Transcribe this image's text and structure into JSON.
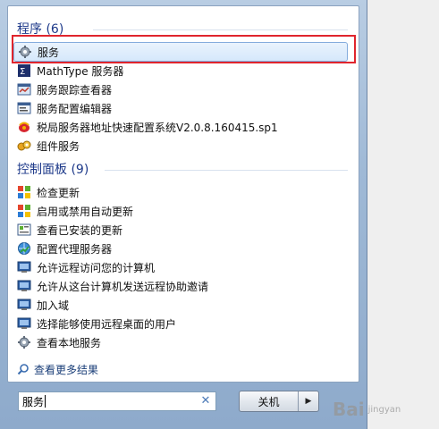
{
  "programs": {
    "header": "程序 (6)",
    "items": [
      {
        "label": "服务",
        "icon": "gear-service-icon"
      },
      {
        "label": "MathType 服务器",
        "icon": "mathtype-icon"
      },
      {
        "label": "服务跟踪查看器",
        "icon": "trace-viewer-icon"
      },
      {
        "label": "服务配置编辑器",
        "icon": "config-editor-icon"
      },
      {
        "label": "税局服务器地址快速配置系统V2.0.8.160415.sp1",
        "icon": "tax-config-icon"
      },
      {
        "label": "组件服务",
        "icon": "component-services-icon"
      }
    ]
  },
  "control_panel": {
    "header": "控制面板 (9)",
    "items": [
      {
        "label": "检查更新",
        "icon": "windows-update-icon"
      },
      {
        "label": "启用或禁用自动更新",
        "icon": "windows-update-icon"
      },
      {
        "label": "查看已安装的更新",
        "icon": "installed-updates-icon"
      },
      {
        "label": "配置代理服务器",
        "icon": "proxy-icon"
      },
      {
        "label": "允许远程访问您的计算机",
        "icon": "remote-access-icon"
      },
      {
        "label": "允许从这台计算机发送远程协助邀请",
        "icon": "remote-assist-icon"
      },
      {
        "label": "加入域",
        "icon": "join-domain-icon"
      },
      {
        "label": "选择能够使用远程桌面的用户",
        "icon": "remote-desktop-users-icon"
      },
      {
        "label": "查看本地服务",
        "icon": "local-services-icon"
      }
    ]
  },
  "see_more": "查看更多结果",
  "search": {
    "value": "服务"
  },
  "shutdown": {
    "label": "关机"
  },
  "watermark": {
    "text": "Bai",
    "sub": "jingyan"
  }
}
